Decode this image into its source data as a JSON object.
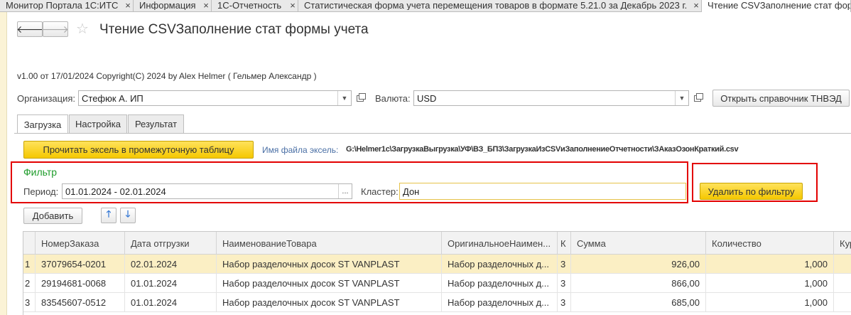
{
  "tabs": [
    {
      "label": "Монитор Портала 1С:ИТС",
      "close": "×"
    },
    {
      "label": "Информация",
      "close": "×"
    },
    {
      "label": "1С-Отчетность",
      "close": "×"
    },
    {
      "label": "Статистическая форма учета перемещения товаров в формате 5.21.0 за Декабрь 2023 г.",
      "close": "×"
    },
    {
      "label": "Чтение CSVЗаполнение стат формы учета",
      "close": ""
    }
  ],
  "nav": {
    "back": "🡐",
    "forward": "🡒",
    "star": "☆"
  },
  "form": {
    "title": "Чтение CSVЗаполнение стат формы учета",
    "version": "v1.00 от 17/01/2024  Copyright(C) 2024 by Alex Helmer ( Гельмер Александр )"
  },
  "org": {
    "label": "Организация:",
    "value": "Стефюк А. ИП"
  },
  "currency": {
    "label": "Валюта:",
    "value": "USD"
  },
  "open_tnved_label": "Открыть справочник ТНВЭД",
  "form_tabs": [
    "Загрузка",
    "Настройка",
    "Результат"
  ],
  "read_excel_label": "Прочитать эксель в промежуточную таблицу",
  "file": {
    "label": "Имя файла эксель:",
    "path": "G:\\Helmer1c\\ЗагрузкаВыгрузка\\УФ\\ВЗ_БП3\\ЗагрузкаИзCSVиЗаполнениеОтчетности\\ЗАказОзонКраткий.csv"
  },
  "filter": {
    "header": "Фильтр",
    "period_label": "Период:",
    "period_value": "01.01.2024 - 02.01.2024",
    "cluster_label": "Кластер:",
    "cluster_value": "Дон",
    "delete_label": "Удалить по фильтру"
  },
  "add_label": "Добавить",
  "move_up": "🡑",
  "move_down": "🡓",
  "grid": {
    "columns": [
      "НомерЗаказа",
      "Дата отгрузки",
      "НаименованиеТовара",
      "ОригинальноеНаимен...",
      "К",
      "Сумма",
      "Количество",
      "Кур"
    ],
    "rows": [
      {
        "idx": "1",
        "order": "37079654-0201",
        "date": "02.01.2024",
        "name": "Набор разделочных досок ST VANPLAST",
        "orig": "Набор разделочных д...",
        "k": "3",
        "sum": "926,00",
        "qty": "1,000"
      },
      {
        "idx": "2",
        "order": "29194681-0068",
        "date": "01.01.2024",
        "name": "Набор разделочных досок ST VANPLAST",
        "orig": "Набор разделочных д...",
        "k": "3",
        "sum": "866,00",
        "qty": "1,000"
      },
      {
        "idx": "3",
        "order": "83545607-0512",
        "date": "01.01.2024",
        "name": "Набор разделочных досок ST VANPLAST",
        "orig": "Набор разделочных д...",
        "k": "3",
        "sum": "685,00",
        "qty": "1,000"
      }
    ]
  },
  "colors": {
    "accent_yellow": "#f5c800",
    "filter_green": "#1e9c2a",
    "highlight_red": "#e30000",
    "selected_row": "#fbefc4"
  }
}
